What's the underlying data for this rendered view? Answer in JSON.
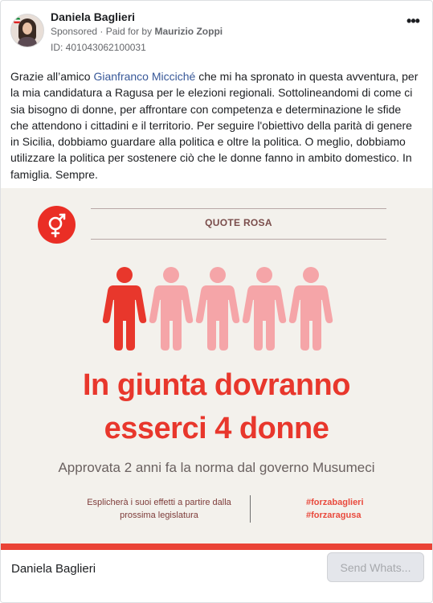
{
  "post": {
    "author": "Daniela Baglieri",
    "sponsored": "Sponsored",
    "paid_for_prefix": "Paid for by",
    "payer": "Maurizio Zoppi",
    "ad_id": "ID: 401043062100031",
    "more_label": "•••",
    "text_before_mention": "Grazie all’amico ",
    "mention": "Gianfranco Micciché",
    "text_after_mention": " che mi ha spronato in questa avventura, per la mia candidatura a Ragusa per le elezioni regionali. Sottolineandomi di come ci sia bisogno di donne, per affrontare con competenza e determinazione le sfide che attendono i cittadini e il territorio. Per seguire l'obiettivo della parità di genere in Sicilia, dobbiamo guardare alla politica e oltre la politica. O meglio, dobbiamo utilizzare la politica per sostenere ciò che le donne fanno in ambito domestico. In famiglia. Sempre."
  },
  "creative": {
    "section_title": "QUOTE ROSA",
    "headline_line1": "In giunta dovranno",
    "headline_line2": "esserci 4 donne",
    "subline": "Approvata 2 anni fa la norma dal governo Musumeci",
    "effect_text": "Esplicherà i suoi effetti a partire dalla prossima legislatura",
    "hashtags": [
      "#forzabaglieri",
      "#forzaragusa"
    ],
    "people": [
      {
        "color": "#e8372c"
      },
      {
        "color": "#f5a5a8"
      },
      {
        "color": "#f5a5a8"
      },
      {
        "color": "#f5a5a8"
      },
      {
        "color": "#f5a5a8"
      }
    ],
    "icon": "gender-symbol-icon",
    "accent_color": "#e8372c"
  },
  "footer": {
    "page_name": "Daniela Baglieri",
    "cta_label": "Send Whats..."
  }
}
